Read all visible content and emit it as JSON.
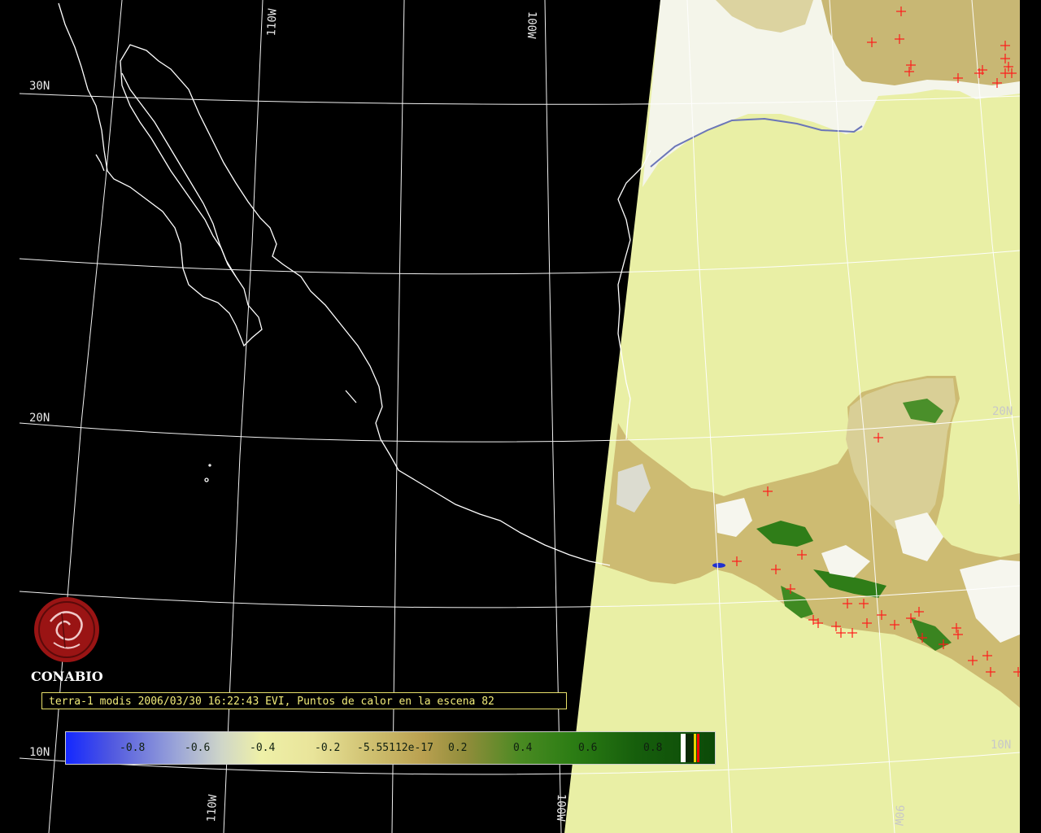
{
  "map": {
    "graticule_labels": {
      "lat": [
        "30N",
        "20N",
        "10N",
        "20N",
        "10N"
      ],
      "lon": [
        "110W",
        "100W",
        "110W",
        "100W",
        "90W"
      ]
    },
    "colors": {
      "background": "#000000",
      "coastline": "#ffffff",
      "graticule": "#ffffff",
      "ocean_swath": "#e9efa5",
      "hotspot": "#ff1a1a",
      "land_low": "#c9b46a",
      "land_high": "#2f7d18"
    },
    "hotspot_marker": "+"
  },
  "logo": {
    "name": "CONABIO",
    "icon": "conabio-logo-icon"
  },
  "caption": {
    "text": "terra-1 modis 2006/03/30 16:22:43 EVI, Puntos de calor en la escena 82"
  },
  "colorbar": {
    "ticks": [
      "-0.8",
      "-0.6",
      "-0.4",
      "-0.2",
      "-5.55112e-17",
      "0.2",
      "0.4",
      "0.6",
      "0.8"
    ],
    "extra_swatches": [
      "#ffffff",
      "#000000",
      "#e8d000",
      "#ff0000"
    ]
  }
}
